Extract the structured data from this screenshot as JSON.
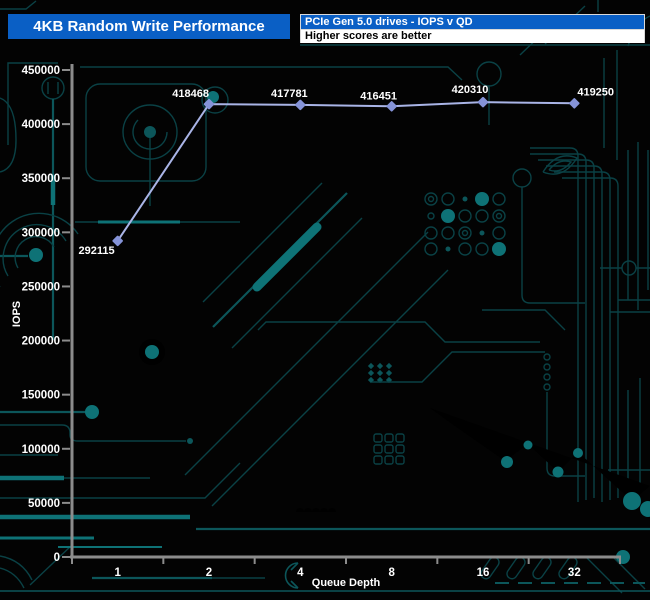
{
  "header": {
    "title": "4KB Random Write Performance",
    "subtitle_top": "PCIe Gen 5.0 drives - IOPS v QD",
    "subtitle_bottom": "Higher scores are better"
  },
  "colors": {
    "background": "#030303",
    "title_bar": "#0a5fc5",
    "subtitle_note_bg": "#ffffff",
    "axis": "#8c8c8c",
    "text": "#ffffff",
    "series_line": "#a9b4e6",
    "series_marker": "#8593d8",
    "circuit_dim": "#0a4145",
    "circuit_mid": "#0c565a",
    "circuit_bright": "#0e7276"
  },
  "chart_data": {
    "type": "line",
    "title": "4KB Random Write Performance",
    "xlabel": "Queue Depth",
    "ylabel": "IOPS",
    "categories": [
      "1",
      "2",
      "4",
      "8",
      "16",
      "32"
    ],
    "series": [
      {
        "name": "PCIe Gen 5.0 drive",
        "values": [
          292115,
          418468,
          417781,
          416451,
          420310,
          419250
        ]
      }
    ],
    "ylim": [
      0,
      450000
    ],
    "y_tick_step": 50000,
    "grid": false,
    "legend": "none",
    "x_scale": "log2-categories",
    "point_labels_shown": true
  }
}
